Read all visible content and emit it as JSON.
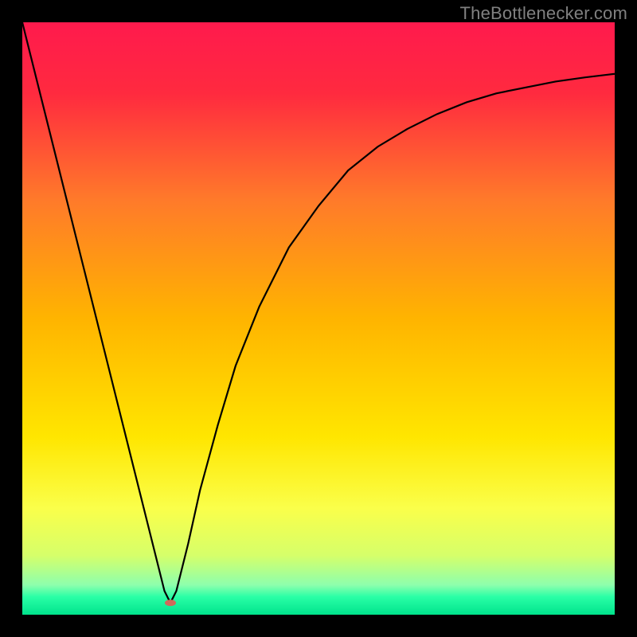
{
  "watermark": "TheBottlenecker.com",
  "chart_data": {
    "type": "line",
    "title": "",
    "xlabel": "",
    "ylabel": "",
    "xlim": [
      0,
      100
    ],
    "ylim": [
      0,
      100
    ],
    "background_gradient": {
      "stops": [
        {
          "offset": 0.0,
          "color": "#ff1a4d"
        },
        {
          "offset": 0.12,
          "color": "#ff2a3f"
        },
        {
          "offset": 0.3,
          "color": "#ff7a2a"
        },
        {
          "offset": 0.5,
          "color": "#ffb400"
        },
        {
          "offset": 0.7,
          "color": "#ffe600"
        },
        {
          "offset": 0.82,
          "color": "#faff4a"
        },
        {
          "offset": 0.9,
          "color": "#d6ff6a"
        },
        {
          "offset": 0.95,
          "color": "#8dffad"
        },
        {
          "offset": 0.97,
          "color": "#29ffa6"
        },
        {
          "offset": 1.0,
          "color": "#00e38c"
        }
      ]
    },
    "marker": {
      "x": 25,
      "y": 2,
      "color": "#d06a5a"
    },
    "series": [
      {
        "name": "curve",
        "x": [
          0,
          5,
          10,
          15,
          20,
          24,
          25,
          26,
          28,
          30,
          33,
          36,
          40,
          45,
          50,
          55,
          60,
          65,
          70,
          75,
          80,
          85,
          90,
          95,
          100
        ],
        "y": [
          100,
          80,
          60,
          40,
          20,
          4,
          2,
          4,
          12,
          21,
          32,
          42,
          52,
          62,
          69,
          75,
          79,
          82,
          84.5,
          86.5,
          88,
          89,
          90,
          90.7,
          91.3
        ]
      }
    ]
  }
}
